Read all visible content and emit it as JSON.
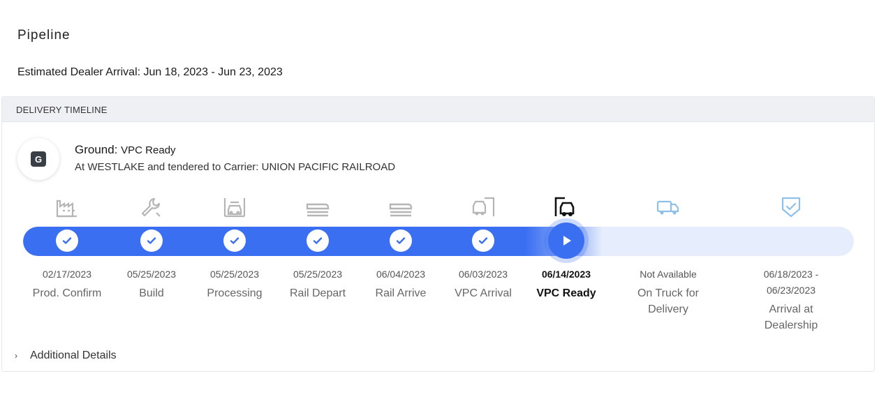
{
  "page": {
    "title": "Pipeline",
    "eta_label": "Estimated Dealer Arrival: Jun 18, 2023 - Jun 23, 2023"
  },
  "timeline": {
    "header": "DELIVERY TIMELINE",
    "mode_letter": "G",
    "mode_label": "Ground:",
    "mode_status": "VPC Ready",
    "location": "At WESTLAKE and tendered to Carrier: UNION PACIFIC RAILROAD",
    "progress_color": "#3a6ff2",
    "milestones": [
      {
        "icon": "factory-icon",
        "date": "02/17/2023",
        "label": "Prod. Confirm",
        "state": "complete"
      },
      {
        "icon": "wrench-icon",
        "date": "05/25/2023",
        "label": "Build",
        "state": "complete"
      },
      {
        "icon": "processing-icon",
        "date": "05/25/2023",
        "label": "Processing",
        "state": "complete"
      },
      {
        "icon": "rail-depart-icon",
        "date": "05/25/2023",
        "label": "Rail Depart",
        "state": "complete"
      },
      {
        "icon": "rail-arrive-icon",
        "date": "06/04/2023",
        "label": "Rail Arrive",
        "state": "complete"
      },
      {
        "icon": "vpc-arrival-icon",
        "date": "06/03/2023",
        "label": "VPC Arrival",
        "state": "complete"
      },
      {
        "icon": "vpc-ready-icon",
        "date": "06/14/2023",
        "label": "VPC Ready",
        "state": "current"
      },
      {
        "icon": "truck-icon",
        "date": "Not Available",
        "label": "On Truck for Delivery",
        "state": "pending"
      },
      {
        "icon": "shield-check-icon",
        "date": "06/18/2023 - 06/23/2023",
        "label": "Arrival at Dealership",
        "state": "pending"
      }
    ],
    "additional_details": "Additional Details"
  }
}
